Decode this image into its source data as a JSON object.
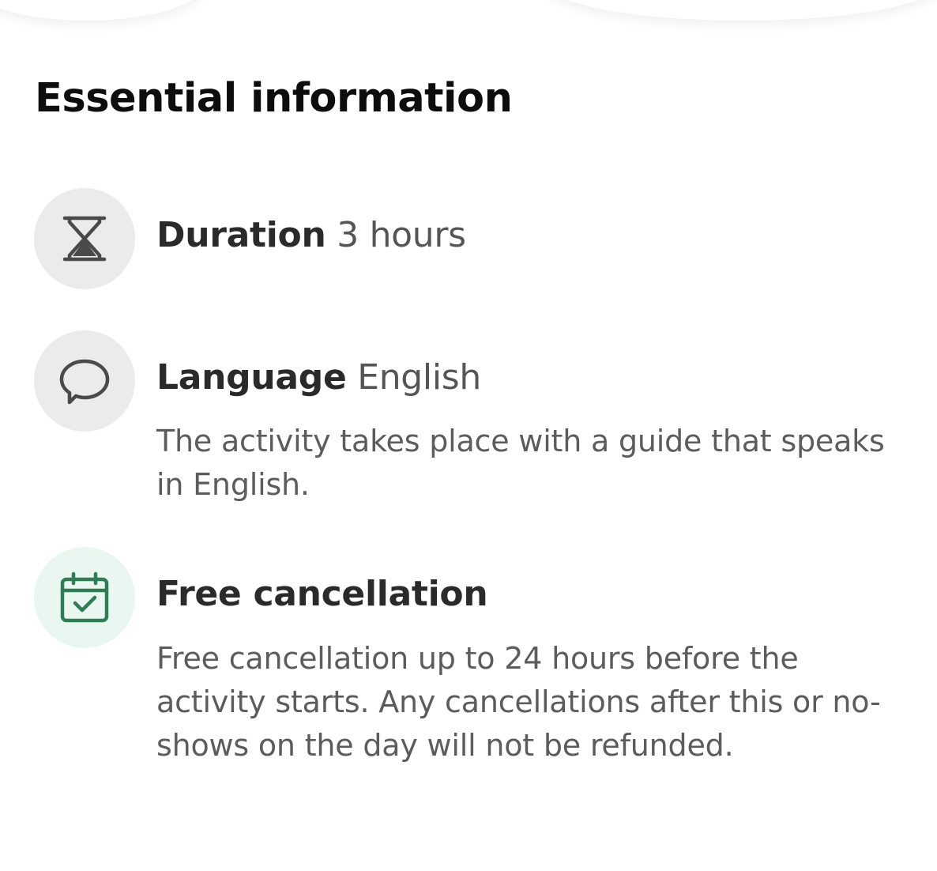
{
  "section": {
    "title": "Essential information"
  },
  "items": [
    {
      "icon": "hourglass-icon",
      "label": "Duration",
      "value": "3 hours",
      "description": ""
    },
    {
      "icon": "speech-bubble-icon",
      "label": "Language",
      "value": "English",
      "description": "The activity takes place with a guide that speaks in English."
    },
    {
      "icon": "calendar-check-icon",
      "label": "Free cancellation",
      "value": "",
      "description": "Free cancellation up to 24 hours before the activity starts. Any cancellations after this  or no-shows on the day will not be refunded."
    }
  ],
  "colors": {
    "icon_gray": "#4a4a4a",
    "icon_green": "#2e7d57",
    "circle_gray": "#ebebeb",
    "circle_green": "#eaf7f0"
  }
}
